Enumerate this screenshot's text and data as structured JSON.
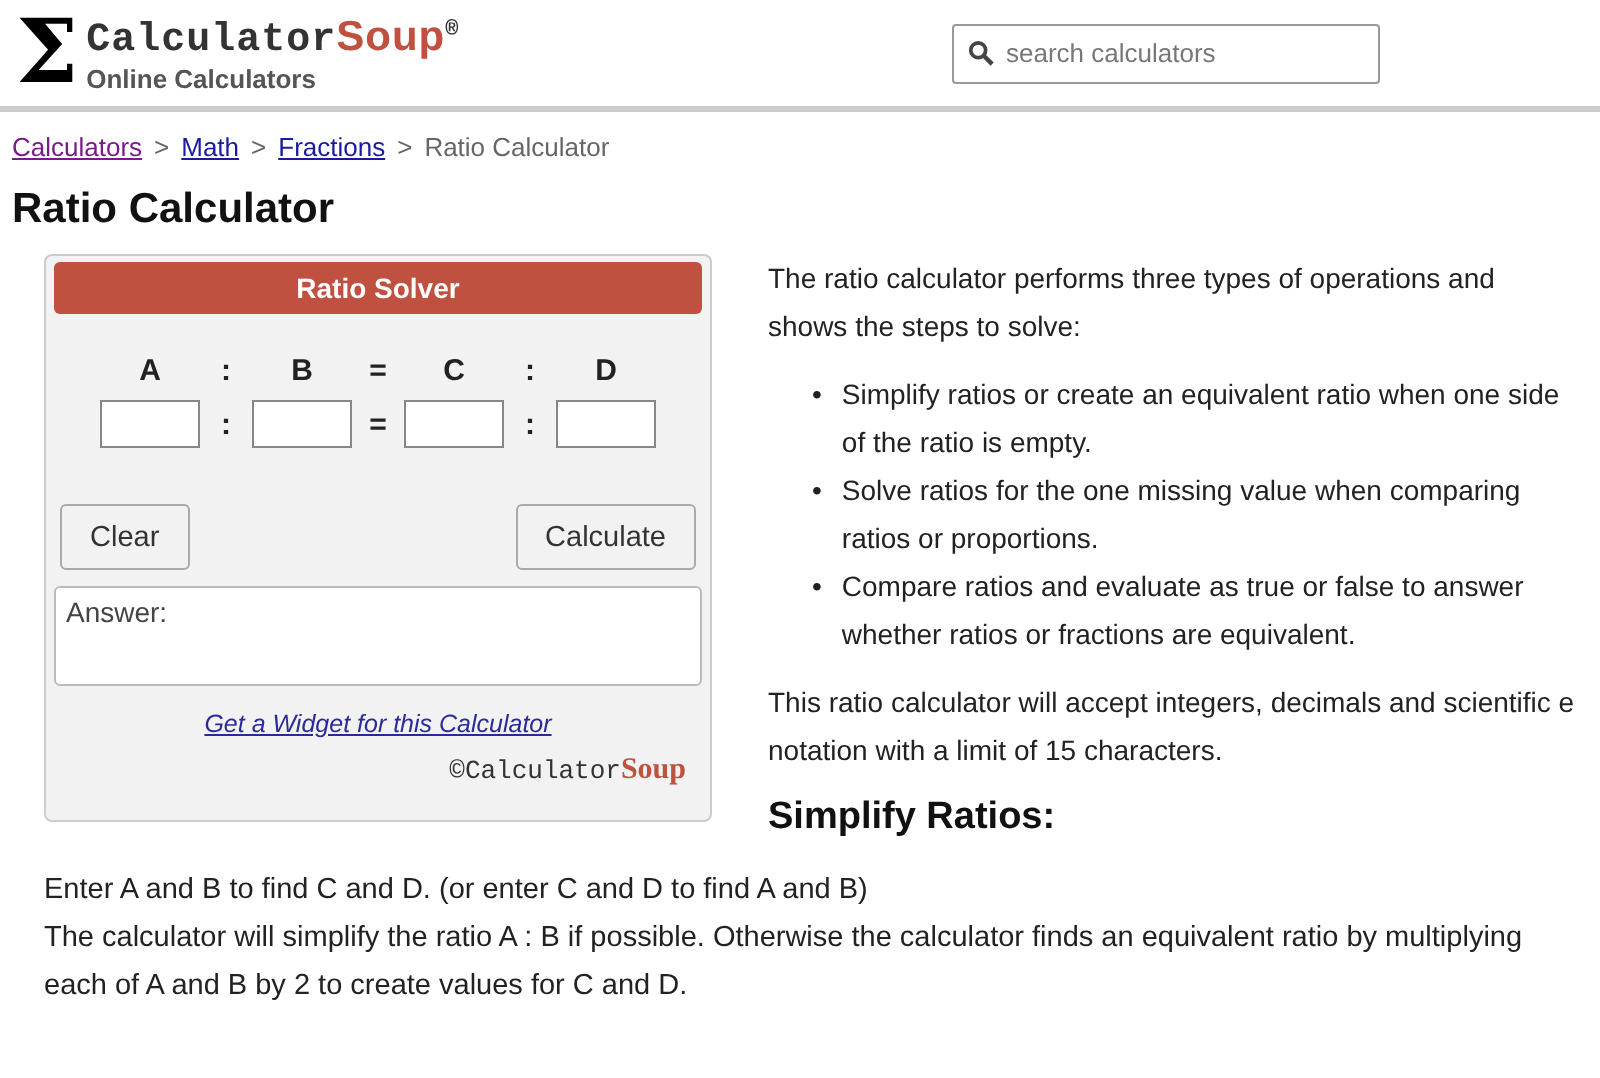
{
  "header": {
    "logo_symbol": "Σ",
    "brand_main": "Calculator",
    "brand_accent": "Soup",
    "brand_mark": "®",
    "tagline": "Online Calculators",
    "search": {
      "placeholder": "search calculators"
    }
  },
  "breadcrumbs": [
    {
      "label": "Calculators",
      "visited": true
    },
    {
      "label": "Math",
      "visited": false
    },
    {
      "label": "Fractions",
      "visited": false
    }
  ],
  "breadcrumb_current": "Ratio Calculator",
  "breadcrumb_separator": ">",
  "title": "Ratio Calculator",
  "solver": {
    "title": "Ratio Solver",
    "variables": [
      "A",
      "B",
      "C",
      "D"
    ],
    "header_separators": [
      ":",
      "=",
      ":"
    ],
    "input_separators": [
      ":",
      "=",
      ":"
    ],
    "buttons": [
      {
        "label": "Clear"
      },
      {
        "label": "Calculate"
      }
    ],
    "answer_label": "Answer:",
    "widget_link": "Get a Widget for this Calculator",
    "credit": {
      "symbol": "©",
      "main": "Calculator",
      "accent": "Soup"
    }
  },
  "intro": "The ratio calculator performs three types of operations and shows the steps to solve:",
  "bullet_marker": "•",
  "bullets": [
    "Simplify ratios or create an equivalent ratio when one side of the ratio is empty.",
    "Solve ratios for the one missing value when comparing ratios or proportions.",
    "Compare ratios and evaluate as true or false to answer whether ratios or fractions are equivalent."
  ],
  "accept_note": "This ratio calculator will accept integers, decimals and scientific e notation with a limit of 15 characters.",
  "section_heading": "Simplify Ratios:",
  "section_paragraphs": [
    "Enter A and B to find C and D. (or enter C and D to find A and B)",
    "The calculator will simplify the ratio A : B if possible. Otherwise the calculator finds an equivalent ratio by multiplying each of A and B by 2 to create values for C and D."
  ]
}
